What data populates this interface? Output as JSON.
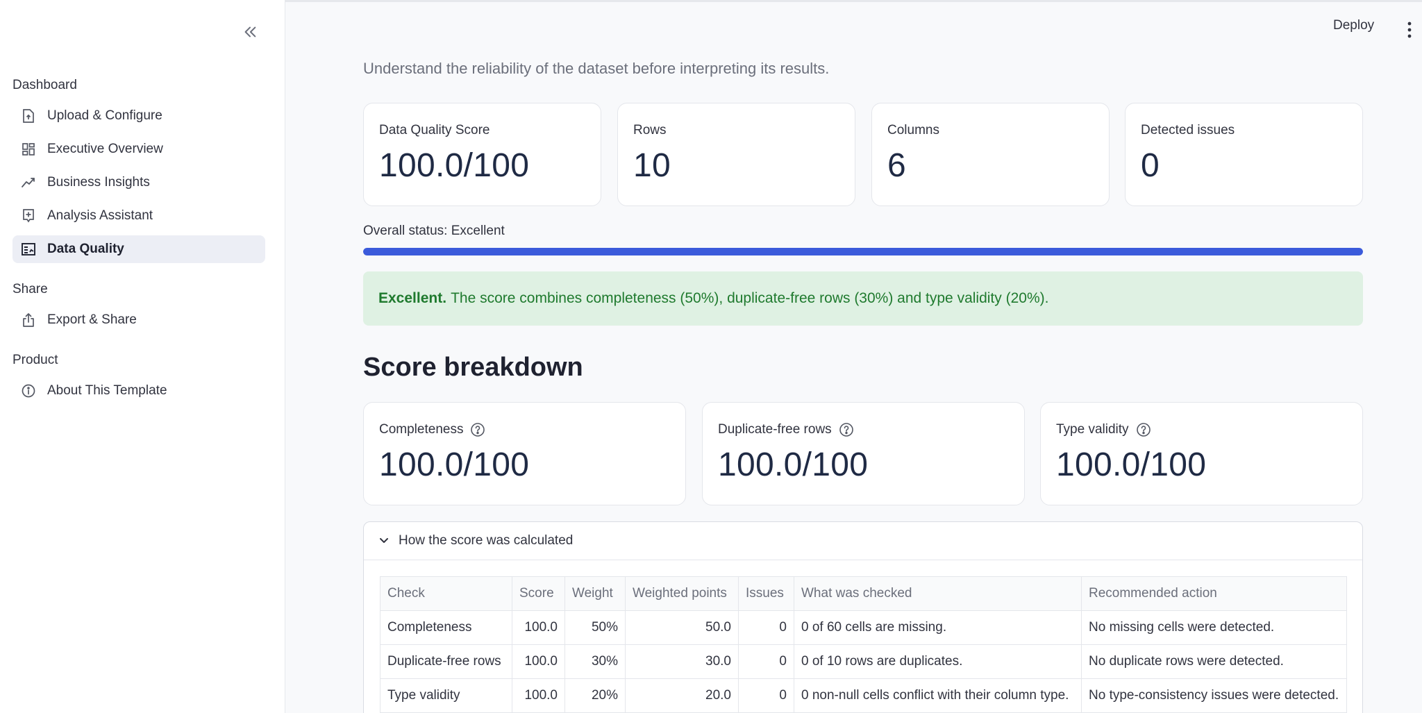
{
  "sidebar": {
    "groups": [
      {
        "label": "Dashboard"
      },
      {
        "label": "Share"
      },
      {
        "label": "Product"
      }
    ],
    "items": [
      {
        "label": "Upload & Configure",
        "icon": "file-upload-icon"
      },
      {
        "label": "Executive Overview",
        "icon": "dashboard-grid-icon"
      },
      {
        "label": "Business Insights",
        "icon": "trend-line-icon"
      },
      {
        "label": "Analysis Assistant",
        "icon": "add-box-icon"
      },
      {
        "label": "Data Quality",
        "icon": "table-chart-icon",
        "active": true
      },
      {
        "label": "Export & Share",
        "icon": "share-export-icon"
      },
      {
        "label": "About This Template",
        "icon": "info-icon"
      }
    ]
  },
  "header": {
    "deploy_label": "Deploy"
  },
  "main": {
    "subtitle": "Understand the reliability of the dataset before interpreting its results.",
    "metrics": [
      {
        "label": "Data Quality Score",
        "value": "100.0/100"
      },
      {
        "label": "Rows",
        "value": "10"
      },
      {
        "label": "Columns",
        "value": "6"
      },
      {
        "label": "Detected issues",
        "value": "0"
      }
    ],
    "status_label": "Overall status: Excellent",
    "progress": 1.0,
    "alert": {
      "bold": "Excellent.",
      "text": "The score combines completeness (50%), duplicate-free rows (30%) and type validity (20%)."
    },
    "breakdown_title": "Score breakdown",
    "breakdown": [
      {
        "label": "Completeness",
        "value": "100.0/100"
      },
      {
        "label": "Duplicate-free rows",
        "value": "100.0/100"
      },
      {
        "label": "Type validity",
        "value": "100.0/100"
      }
    ],
    "expander_label": "How the score was calculated",
    "table": {
      "headers": [
        "Check",
        "Score",
        "Weight",
        "Weighted points",
        "Issues",
        "What was checked",
        "Recommended action"
      ],
      "rows": [
        [
          "Completeness",
          "100.0",
          "50%",
          "50.0",
          "0",
          "0 of 60 cells are missing.",
          "No missing cells were detected."
        ],
        [
          "Duplicate-free rows",
          "100.0",
          "30%",
          "30.0",
          "0",
          "0 of 10 rows are duplicates.",
          "No duplicate rows were detected."
        ],
        [
          "Type validity",
          "100.0",
          "20%",
          "20.0",
          "0",
          "0 non-null cells conflict with their column type.",
          "No type-consistency issues were detected."
        ]
      ]
    }
  },
  "colors": {
    "accent": "#3b5bdb",
    "success_bg": "#dff1e3",
    "success_text": "#1f7a2e"
  }
}
